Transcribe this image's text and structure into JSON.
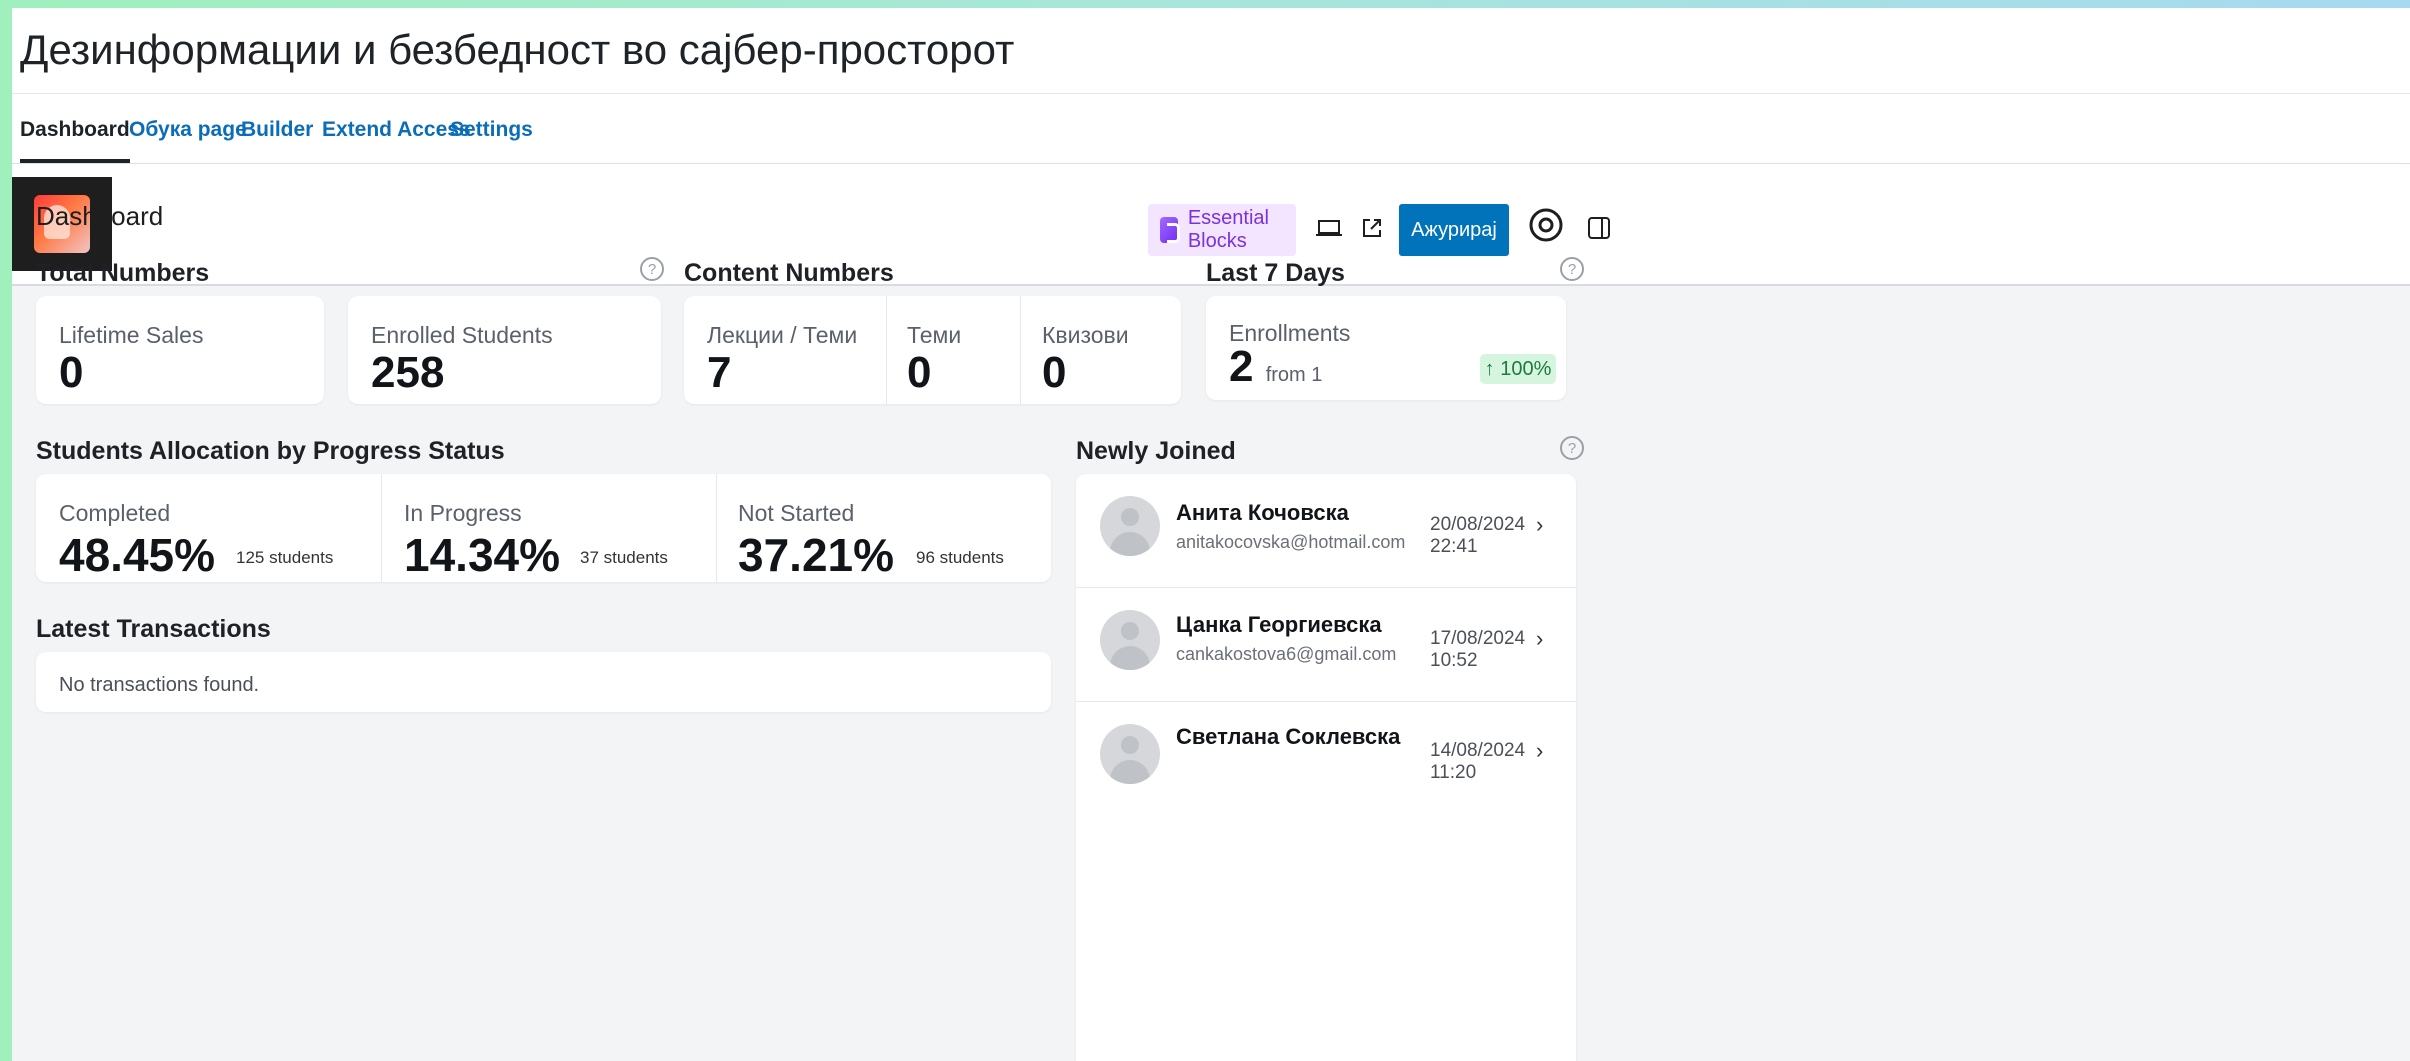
{
  "site_title": "Дезинформации и безбедност во сајбер-просторот",
  "tabs": [
    "Dashboard",
    "Обука page",
    "Builder",
    "Extend Access",
    "Settings"
  ],
  "toolbar": {
    "essential_blocks_label": "Essential Blocks",
    "update_label": "Ажурирај",
    "icons": [
      "laptop-icon",
      "external-link-icon",
      "settings-circle-icon",
      "sidebar-toggle-icon"
    ]
  },
  "page_label": "Dashboard",
  "total_numbers": {
    "title": "Total Numbers",
    "lifetime_sales_label": "Lifetime Sales",
    "lifetime_sales_value": "0",
    "enrolled_label": "Enrolled Students",
    "enrolled_value": "258"
  },
  "content_numbers": {
    "title": "Content Numbers",
    "lectures_label": "Лекции / Теми",
    "lectures_value": "7",
    "topics_label": "Теми",
    "topics_value": "0",
    "quizzes_label": "Квизови",
    "quizzes_value": "0"
  },
  "last7": {
    "title": "Last 7 Days",
    "enrollments_label": "Enrollments",
    "enrollments_value": "2",
    "from_text": "from 1",
    "change": "↑ 100%"
  },
  "progress": {
    "title": "Students Allocation by Progress Status",
    "completed_label": "Completed",
    "completed_pct": "48.45%",
    "completed_students": "125 students",
    "inprogress_label": "In Progress",
    "inprogress_pct": "14.34%",
    "inprogress_students": "37 students",
    "notstarted_label": "Not Started",
    "notstarted_pct": "37.21%",
    "notstarted_students": "96 students"
  },
  "transactions": {
    "title": "Latest Transactions",
    "empty": "No transactions found."
  },
  "newly_joined": {
    "title": "Newly Joined",
    "users": [
      {
        "name": "Анита Кочовска",
        "email": "anitakocovska@hotmail.com",
        "date": "20/08/2024 22:41"
      },
      {
        "name": "Цанка Георгиевска",
        "email": "cankakostova6@gmail.com",
        "date": "17/08/2024 10:52"
      },
      {
        "name": "Светлана Соклевска",
        "email": "",
        "date": "14/08/2024 11:20"
      }
    ]
  },
  "colors": {
    "accent": "#0073ba",
    "badge_bg": "#d6f5de",
    "badge_text": "#1f7a3f",
    "eb_purple": "#7a31e0"
  }
}
